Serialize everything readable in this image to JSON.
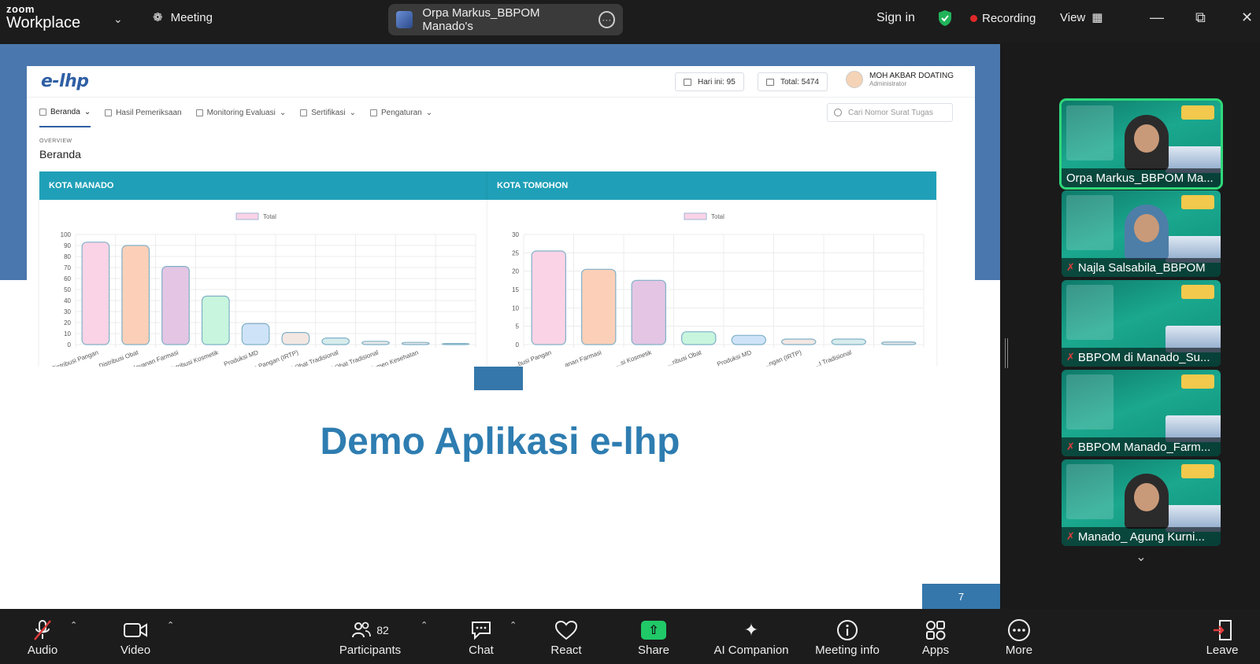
{
  "app": {
    "brand_top": "zoom",
    "brand_bottom": "Workplace",
    "meeting_label": "Meeting"
  },
  "speaker": {
    "name": "Orpa Markus_BBPOM Manado's"
  },
  "topright": {
    "signin": "Sign in",
    "recording": "Recording",
    "view": "View"
  },
  "shared": {
    "logo": "e-lhp",
    "stat_today": "Hari ini: 95",
    "stat_total": "Total: 5474",
    "user_name": "MOH AKBAR DOATING",
    "user_role": "Administrator",
    "nav": [
      "Beranda",
      "Hasil Pemeriksaan",
      "Monitoring Evaluasi",
      "Sertifikasi",
      "Pengaturan"
    ],
    "search_placeholder": "Cari Nomor Surat Tugas",
    "overview_small": "OVERVIEW",
    "overview_title": "Beranda",
    "slide_title": "Demo Aplikasi e-lhp",
    "page_number": "7"
  },
  "chart_data": [
    {
      "type": "bar",
      "title": "KOTA MANADO",
      "legend": "Total",
      "categories": [
        "Distribusi Pangan",
        "Distribusi Obat",
        "Pelayanan Farmasi",
        "Distribusi Kosmetik",
        "Produksi MD",
        "...ngga Pangan (IRTP)",
        "...si Obat Tradisional",
        "...si Obat Tradisional",
        "...lemen Kesehatan",
        ""
      ],
      "values": [
        93,
        90,
        71,
        44,
        19,
        11,
        6,
        3,
        2,
        1
      ],
      "colors": [
        "#fbd3e6",
        "#fcd0b8",
        "#e4c5e4",
        "#c7f5dd",
        "#cfe3f8",
        "#f3e7e2",
        "#d6ecec",
        "#e8e8e8",
        "#e8e8e8",
        "#e8e8e8"
      ],
      "ylim": [
        0,
        100
      ],
      "yticks": [
        0,
        10,
        20,
        30,
        40,
        50,
        60,
        70,
        80,
        90,
        100
      ]
    },
    {
      "type": "bar",
      "title": "KOTA TOMOHON",
      "legend": "Total",
      "categories": [
        "...busi Pangan",
        "...anan Farmasi",
        "...si Kosmetik",
        "...ribusi Obat",
        "Produksi MD",
        "...ngan (IRTP)",
        "...t Tradisional",
        ""
      ],
      "values": [
        25.5,
        20.5,
        17.5,
        3.5,
        2.5,
        1.5,
        1.5,
        0.7
      ],
      "colors": [
        "#fbd3e6",
        "#fcd0b8",
        "#e4c5e4",
        "#c7f5dd",
        "#cfe3f8",
        "#f3e7e2",
        "#d6ecec",
        "#e8e8e8"
      ],
      "ylim": [
        0,
        30
      ],
      "yticks": [
        0,
        5,
        10,
        15,
        20,
        25,
        30
      ]
    }
  ],
  "participants": [
    {
      "name": "Orpa Markus_BBPOM Ma...",
      "muted": false,
      "active": true,
      "person": "woman"
    },
    {
      "name": "Najla Salsabila_BBPOM",
      "muted": true,
      "active": false,
      "person": "hijab"
    },
    {
      "name": "BBPOM di Manado_Su...",
      "muted": true,
      "active": false,
      "person": "none"
    },
    {
      "name": "BBPOM Manado_Farm...",
      "muted": true,
      "active": false,
      "person": "none"
    },
    {
      "name": "Manado_ Agung Kurni...",
      "muted": true,
      "active": false,
      "person": "man"
    }
  ],
  "toolbar": {
    "audio": "Audio",
    "video": "Video",
    "participants": "Participants",
    "participants_count": "82",
    "chat": "Chat",
    "react": "React",
    "share": "Share",
    "ai": "AI Companion",
    "info": "Meeting info",
    "apps": "Apps",
    "more": "More",
    "leave": "Leave"
  }
}
